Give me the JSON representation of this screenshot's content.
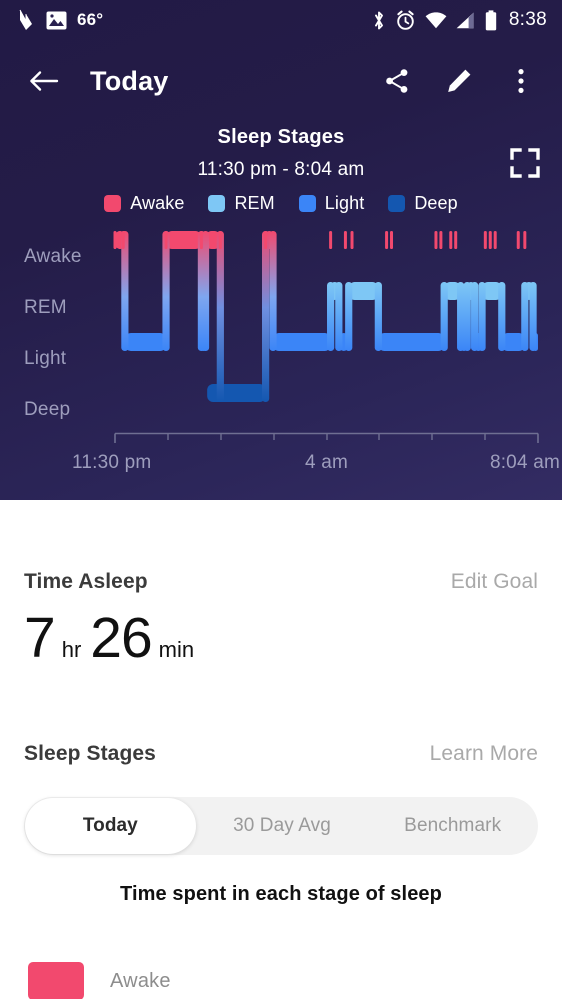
{
  "statusbar": {
    "temperature": "66°",
    "time": "8:38",
    "icons": [
      "activity-icon",
      "photo-icon",
      "bluetooth-icon",
      "alarm-icon",
      "wifi-icon",
      "cell-signal-icon",
      "battery-icon"
    ]
  },
  "appbar": {
    "title": "Today",
    "back_label": "Back",
    "share_label": "Share",
    "edit_label": "Edit",
    "more_label": "More options"
  },
  "chart_header": {
    "title": "Sleep Stages",
    "subtitle": "11:30 pm - 8:04 am",
    "expand_label": "Fullscreen"
  },
  "legend": [
    {
      "label": "Awake",
      "color": "#f2496e"
    },
    {
      "label": "REM",
      "color": "#7ec7f5"
    },
    {
      "label": "Light",
      "color": "#3b85f7"
    },
    {
      "label": "Deep",
      "color": "#1457b0"
    }
  ],
  "chart_data": {
    "type": "area",
    "title": "Sleep Stages",
    "subtitle": "11:30 pm - 8:04 am",
    "xlabel": "",
    "ylabel": "",
    "grid": false,
    "legend_position": "top",
    "stages": [
      "Awake",
      "REM",
      "Light",
      "Deep"
    ],
    "stage_colors": {
      "Awake": "#f2496e",
      "REM": "#7ec7f5",
      "Light": "#3b85f7",
      "Deep": "#1457b0"
    },
    "ytick_labels": [
      "Awake",
      "REM",
      "Light",
      "Deep"
    ],
    "xtick_labels": [
      "11:30 pm",
      "4 am",
      "8:04 am"
    ],
    "x_start": "11:30 pm",
    "x_end": "8:04 am",
    "xlim_minutes": [
      0,
      514
    ],
    "segments": [
      {
        "stage": "Awake",
        "start": 0,
        "end": 12
      },
      {
        "stage": "Light",
        "start": 12,
        "end": 62
      },
      {
        "stage": "Awake",
        "start": 62,
        "end": 105
      },
      {
        "stage": "Light",
        "start": 105,
        "end": 110
      },
      {
        "stage": "Awake",
        "start": 110,
        "end": 128
      },
      {
        "stage": "Light",
        "start": 128,
        "end": 118
      },
      {
        "stage": "Deep",
        "start": 112,
        "end": 183
      },
      {
        "stage": "Awake",
        "start": 183,
        "end": 192
      },
      {
        "stage": "Light",
        "start": 192,
        "end": 262
      },
      {
        "stage": "REM",
        "start": 262,
        "end": 272
      },
      {
        "stage": "Light",
        "start": 272,
        "end": 284
      },
      {
        "stage": "REM",
        "start": 284,
        "end": 320
      },
      {
        "stage": "Light",
        "start": 320,
        "end": 400
      },
      {
        "stage": "REM",
        "start": 400,
        "end": 420
      },
      {
        "stage": "Light",
        "start": 420,
        "end": 428
      },
      {
        "stage": "REM",
        "start": 428,
        "end": 437
      },
      {
        "stage": "Light",
        "start": 437,
        "end": 446
      },
      {
        "stage": "REM",
        "start": 446,
        "end": 470
      },
      {
        "stage": "Light",
        "start": 470,
        "end": 498
      },
      {
        "stage": "REM",
        "start": 498,
        "end": 508
      },
      {
        "stage": "Light",
        "start": 508,
        "end": 514
      }
    ],
    "awake_ticks_minutes": [
      0,
      6,
      10,
      62,
      105,
      128,
      183,
      262,
      280,
      288,
      330,
      336,
      390,
      396,
      408,
      414,
      450,
      456,
      462,
      490,
      498
    ]
  },
  "time_asleep": {
    "heading": "Time Asleep",
    "action": "Edit Goal",
    "hours": "7",
    "hours_unit": "hr",
    "minutes": "26",
    "minutes_unit": "min"
  },
  "sleep_stages_section": {
    "heading": "Sleep Stages",
    "action": "Learn More",
    "tabs": [
      {
        "label": "Today",
        "selected": true
      },
      {
        "label": "30 Day Avg",
        "selected": false
      },
      {
        "label": "Benchmark",
        "selected": false
      }
    ],
    "subheading": "Time spent in each stage of sleep",
    "stage_rows": [
      {
        "name": "Awake",
        "color": "#f2496e"
      }
    ]
  }
}
